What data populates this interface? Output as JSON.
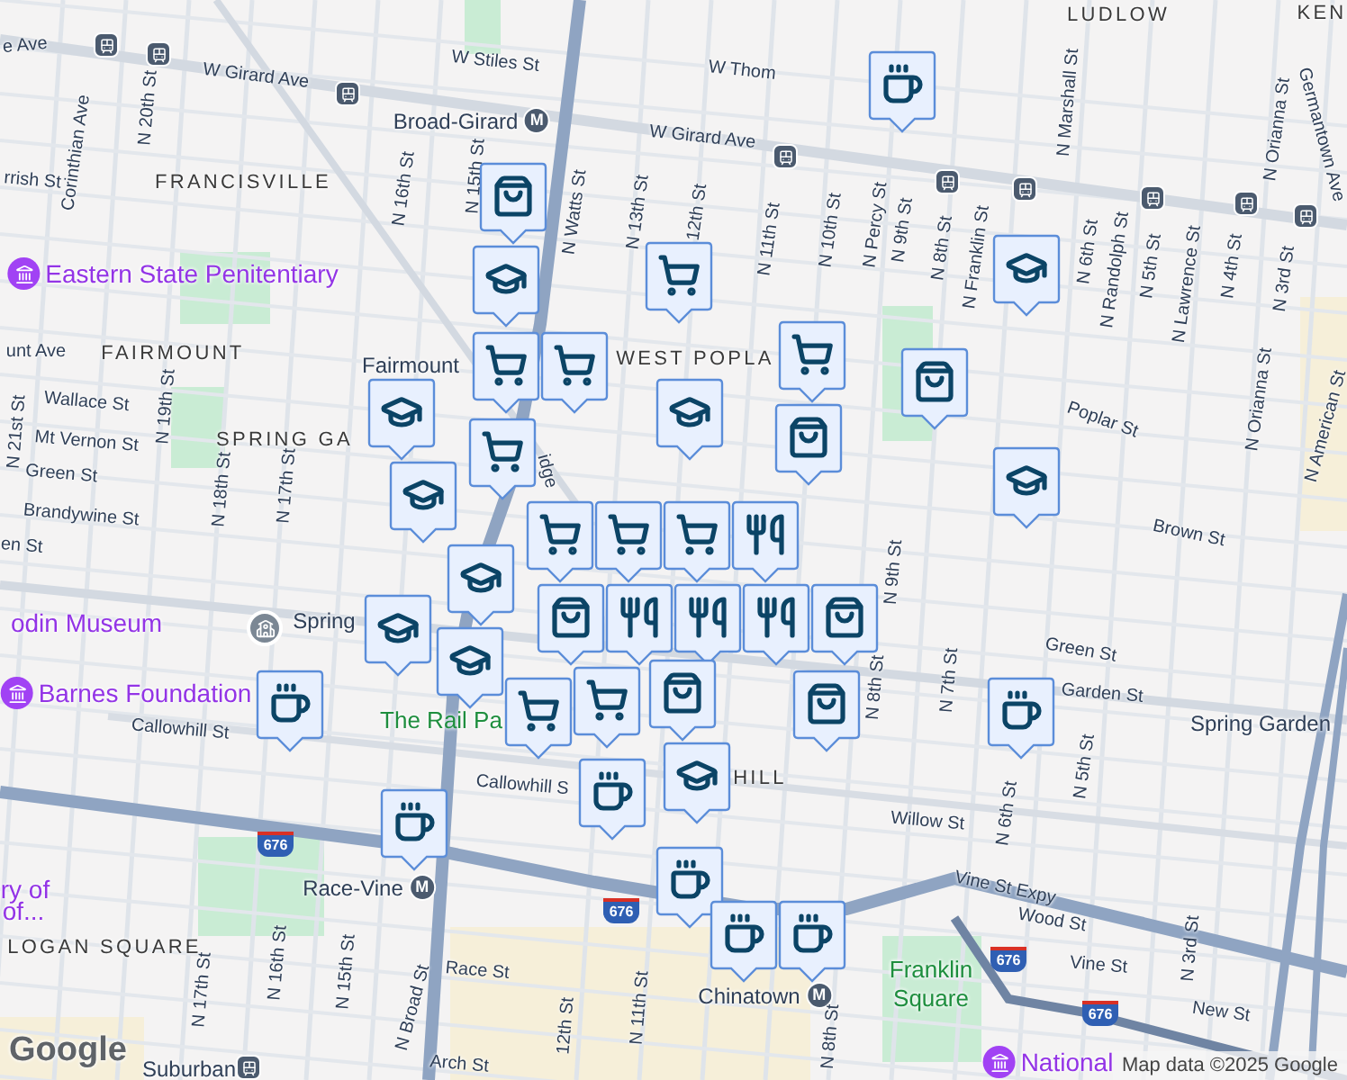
{
  "map": {
    "labels": [
      {
        "text": "LUDLOW",
        "kind": "area"
      },
      {
        "text": "KEN",
        "kind": "area"
      },
      {
        "text": "W Stiles St",
        "kind": "street"
      },
      {
        "text": "e Ave",
        "kind": "street"
      },
      {
        "text": "W Girard Ave",
        "kind": "street"
      },
      {
        "text": "Broad-Girard",
        "kind": "station",
        "badge": "M"
      },
      {
        "text": "W Girard Ave",
        "kind": "street"
      },
      {
        "text": "W Thom",
        "kind": "street"
      },
      {
        "text": "rrish St",
        "kind": "street"
      },
      {
        "text": "Corinthian Ave",
        "kind": "street"
      },
      {
        "text": "N 20th St",
        "kind": "street"
      },
      {
        "text": "FRANCISVILLE",
        "kind": "area"
      },
      {
        "text": "N 16th St",
        "kind": "street"
      },
      {
        "text": "N 15th St",
        "kind": "street"
      },
      {
        "text": "N Watts St",
        "kind": "street"
      },
      {
        "text": "N 13th St",
        "kind": "street"
      },
      {
        "text": "12th St",
        "kind": "street"
      },
      {
        "text": "N 11th St",
        "kind": "street"
      },
      {
        "text": "N 10th St",
        "kind": "street"
      },
      {
        "text": "N Percy St",
        "kind": "street"
      },
      {
        "text": "N 9th St",
        "kind": "street"
      },
      {
        "text": "N 8th St",
        "kind": "street"
      },
      {
        "text": "N Franklin St",
        "kind": "street"
      },
      {
        "text": "N Marshall St",
        "kind": "street"
      },
      {
        "text": "N 6th St",
        "kind": "street"
      },
      {
        "text": "N Randolph St",
        "kind": "street"
      },
      {
        "text": "N 5th St",
        "kind": "street"
      },
      {
        "text": "N Lawrence St",
        "kind": "street"
      },
      {
        "text": "N 4th St",
        "kind": "street"
      },
      {
        "text": "N 3rd St",
        "kind": "street"
      },
      {
        "text": "N Orianna St",
        "kind": "street"
      },
      {
        "text": "Germantown Ave",
        "kind": "street"
      },
      {
        "text": "Eastern State Penitentiary",
        "kind": "landmark"
      },
      {
        "text": "unt Ave",
        "kind": "street"
      },
      {
        "text": "FAIRMOUNT",
        "kind": "area"
      },
      {
        "text": "WEST POPLA",
        "kind": "area"
      },
      {
        "text": "Fairmount",
        "kind": "station"
      },
      {
        "text": "Wallace St",
        "kind": "street"
      },
      {
        "text": "Mt Vernon St",
        "kind": "street"
      },
      {
        "text": "N 21st St",
        "kind": "street"
      },
      {
        "text": "N 19th St",
        "kind": "street"
      },
      {
        "text": "SPRING GA",
        "kind": "area"
      },
      {
        "text": "Green St",
        "kind": "street"
      },
      {
        "text": "Brandywine St",
        "kind": "street"
      },
      {
        "text": "N 18th St",
        "kind": "street"
      },
      {
        "text": "N 17th St",
        "kind": "street"
      },
      {
        "text": "idge",
        "kind": "street"
      },
      {
        "text": "Poplar St",
        "kind": "street"
      },
      {
        "text": "N Orianna St",
        "kind": "street"
      },
      {
        "text": "N American St",
        "kind": "street"
      },
      {
        "text": "Brown St",
        "kind": "street"
      },
      {
        "text": "en St",
        "kind": "street"
      },
      {
        "text": "odin Museum",
        "kind": "poi"
      },
      {
        "text": "Spring",
        "kind": "station"
      },
      {
        "text": "Barnes Foundation",
        "kind": "landmark"
      },
      {
        "text": "Callowhill St",
        "kind": "street"
      },
      {
        "text": "The Rail Pa",
        "kind": "park"
      },
      {
        "text": "Callowhill S",
        "kind": "street"
      },
      {
        "text": "HILL",
        "kind": "area"
      },
      {
        "text": "Green St",
        "kind": "street"
      },
      {
        "text": "Garden St",
        "kind": "street"
      },
      {
        "text": "Spring Garden",
        "kind": "station"
      },
      {
        "text": "N 9th St",
        "kind": "street"
      },
      {
        "text": "N 8th St",
        "kind": "street"
      },
      {
        "text": "N 7th St",
        "kind": "street"
      },
      {
        "text": "N 6th St",
        "kind": "street"
      },
      {
        "text": "N 5th St",
        "kind": "street"
      },
      {
        "text": "Willow St",
        "kind": "street"
      },
      {
        "text": "Vine St Expy",
        "kind": "street"
      },
      {
        "text": "Wood St",
        "kind": "street"
      },
      {
        "text": "Vine St",
        "kind": "street"
      },
      {
        "text": "N 3rd St",
        "kind": "street"
      },
      {
        "text": "New St",
        "kind": "street"
      },
      {
        "text": "Franklin Square",
        "kind": "park"
      },
      {
        "text": "ry of",
        "kind": "poi"
      },
      {
        "text": "of...",
        "kind": "poi"
      },
      {
        "text": "Race-Vine",
        "kind": "station",
        "badge": "M"
      },
      {
        "text": "LOGAN SQUARE",
        "kind": "area"
      },
      {
        "text": "N 17th St",
        "kind": "street"
      },
      {
        "text": "N 16th St",
        "kind": "street"
      },
      {
        "text": "N 15th St",
        "kind": "street"
      },
      {
        "text": "N Broad St",
        "kind": "street"
      },
      {
        "text": "Race St",
        "kind": "street"
      },
      {
        "text": "12th St",
        "kind": "street"
      },
      {
        "text": "N 11th St",
        "kind": "street"
      },
      {
        "text": "Arch St",
        "kind": "street"
      },
      {
        "text": "Suburban",
        "kind": "station"
      },
      {
        "text": "Chinatown",
        "kind": "station",
        "badge": "M"
      },
      {
        "text": "National",
        "kind": "landmark"
      },
      {
        "text": "N 8th St",
        "kind": "street"
      }
    ],
    "shields": [
      "676",
      "676",
      "676",
      "676"
    ]
  },
  "markers": [
    {
      "kind": "coffee"
    },
    {
      "kind": "bag"
    },
    {
      "kind": "school"
    },
    {
      "kind": "cart"
    },
    {
      "kind": "cart"
    },
    {
      "kind": "cart"
    },
    {
      "kind": "school"
    },
    {
      "kind": "school"
    },
    {
      "kind": "cart"
    },
    {
      "kind": "bag"
    },
    {
      "kind": "bag"
    },
    {
      "kind": "school"
    },
    {
      "kind": "school"
    },
    {
      "kind": "cart"
    },
    {
      "kind": "school"
    },
    {
      "kind": "cart"
    },
    {
      "kind": "cart"
    },
    {
      "kind": "cart"
    },
    {
      "kind": "food"
    },
    {
      "kind": "school"
    },
    {
      "kind": "bag"
    },
    {
      "kind": "food"
    },
    {
      "kind": "food"
    },
    {
      "kind": "food"
    },
    {
      "kind": "bag"
    },
    {
      "kind": "school"
    },
    {
      "kind": "school"
    },
    {
      "kind": "bag"
    },
    {
      "kind": "cart"
    },
    {
      "kind": "bag"
    },
    {
      "kind": "cart"
    },
    {
      "kind": "coffee"
    },
    {
      "kind": "coffee"
    },
    {
      "kind": "school"
    },
    {
      "kind": "coffee"
    },
    {
      "kind": "coffee"
    },
    {
      "kind": "coffee"
    },
    {
      "kind": "coffee"
    },
    {
      "kind": "coffee"
    }
  ],
  "attribution": {
    "logo": "Google",
    "text": "Map data ©2025 Google"
  }
}
